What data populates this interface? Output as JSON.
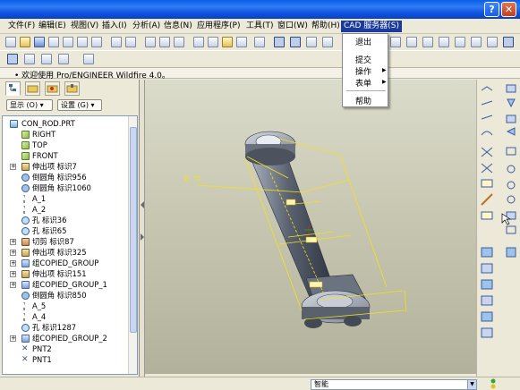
{
  "window": {
    "help_glyph": "?",
    "close_glyph": "✕"
  },
  "menubar": [
    "文件(F)",
    "编辑(E)",
    "视图(V)",
    "插入(I)",
    "分析(A)",
    "信息(N)",
    "应用程序(P)",
    "工具(T)",
    "窗口(W)",
    "帮助(H)",
    "CAD 服务器(S)"
  ],
  "cad_menu": {
    "items": [
      "退出",
      "提交",
      "操作",
      "表单",
      "帮助"
    ]
  },
  "message_bar": {
    "text": "• 欢迎使用 Pro/ENGINEER Wildfire 4.0。"
  },
  "panel": {
    "display_combo": "显示 (O) ▾",
    "settings_combo": "设置 (G) ▾"
  },
  "tree": {
    "rows": [
      "CON_ROD.PRT",
      "RIGHT",
      "TOP",
      "FRONT",
      "伸出项 标识7",
      "倒圆角 标识956",
      "倒圆角 标识1060",
      "A_1",
      "A_2",
      "孔 标识36",
      "孔 标识65",
      "切剪 标识87",
      "伸出项 标识325",
      "组COPIED_GROUP",
      "伸出项 标识151",
      "组COPIED_GROUP_1",
      "倒圆角 标识850",
      "A_5",
      "A_4",
      "孔 标识1287",
      "组COPIED_GROUP_2",
      "PNT2",
      "PNT1"
    ]
  },
  "model": {
    "dim_label": "Ø .75"
  },
  "status": {
    "filter_value": "智能"
  }
}
